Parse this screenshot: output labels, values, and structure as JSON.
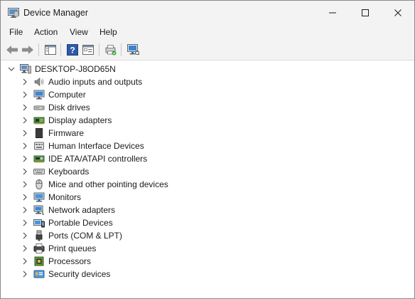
{
  "window": {
    "title": "Device Manager"
  },
  "menu": {
    "items": [
      "File",
      "Action",
      "View",
      "Help"
    ]
  },
  "tree": {
    "root": "DESKTOP-J8OD65N",
    "items": [
      {
        "label": "Audio inputs and outputs",
        "icon": "speaker-icon"
      },
      {
        "label": "Computer",
        "icon": "computer-icon"
      },
      {
        "label": "Disk drives",
        "icon": "disk-drive-icon"
      },
      {
        "label": "Display adapters",
        "icon": "display-adapter-icon"
      },
      {
        "label": "Firmware",
        "icon": "firmware-icon"
      },
      {
        "label": "Human Interface Devices",
        "icon": "hid-icon"
      },
      {
        "label": "IDE ATA/ATAPI controllers",
        "icon": "ide-controller-icon"
      },
      {
        "label": "Keyboards",
        "icon": "keyboard-icon"
      },
      {
        "label": "Mice and other pointing devices",
        "icon": "mouse-icon"
      },
      {
        "label": "Monitors",
        "icon": "monitor-icon"
      },
      {
        "label": "Network adapters",
        "icon": "network-adapter-icon"
      },
      {
        "label": "Portable Devices",
        "icon": "portable-device-icon"
      },
      {
        "label": "Ports (COM & LPT)",
        "icon": "port-icon"
      },
      {
        "label": "Print queues",
        "icon": "printer-icon"
      },
      {
        "label": "Processors",
        "icon": "processor-icon"
      },
      {
        "label": "Security devices",
        "icon": "security-device-icon"
      }
    ]
  }
}
